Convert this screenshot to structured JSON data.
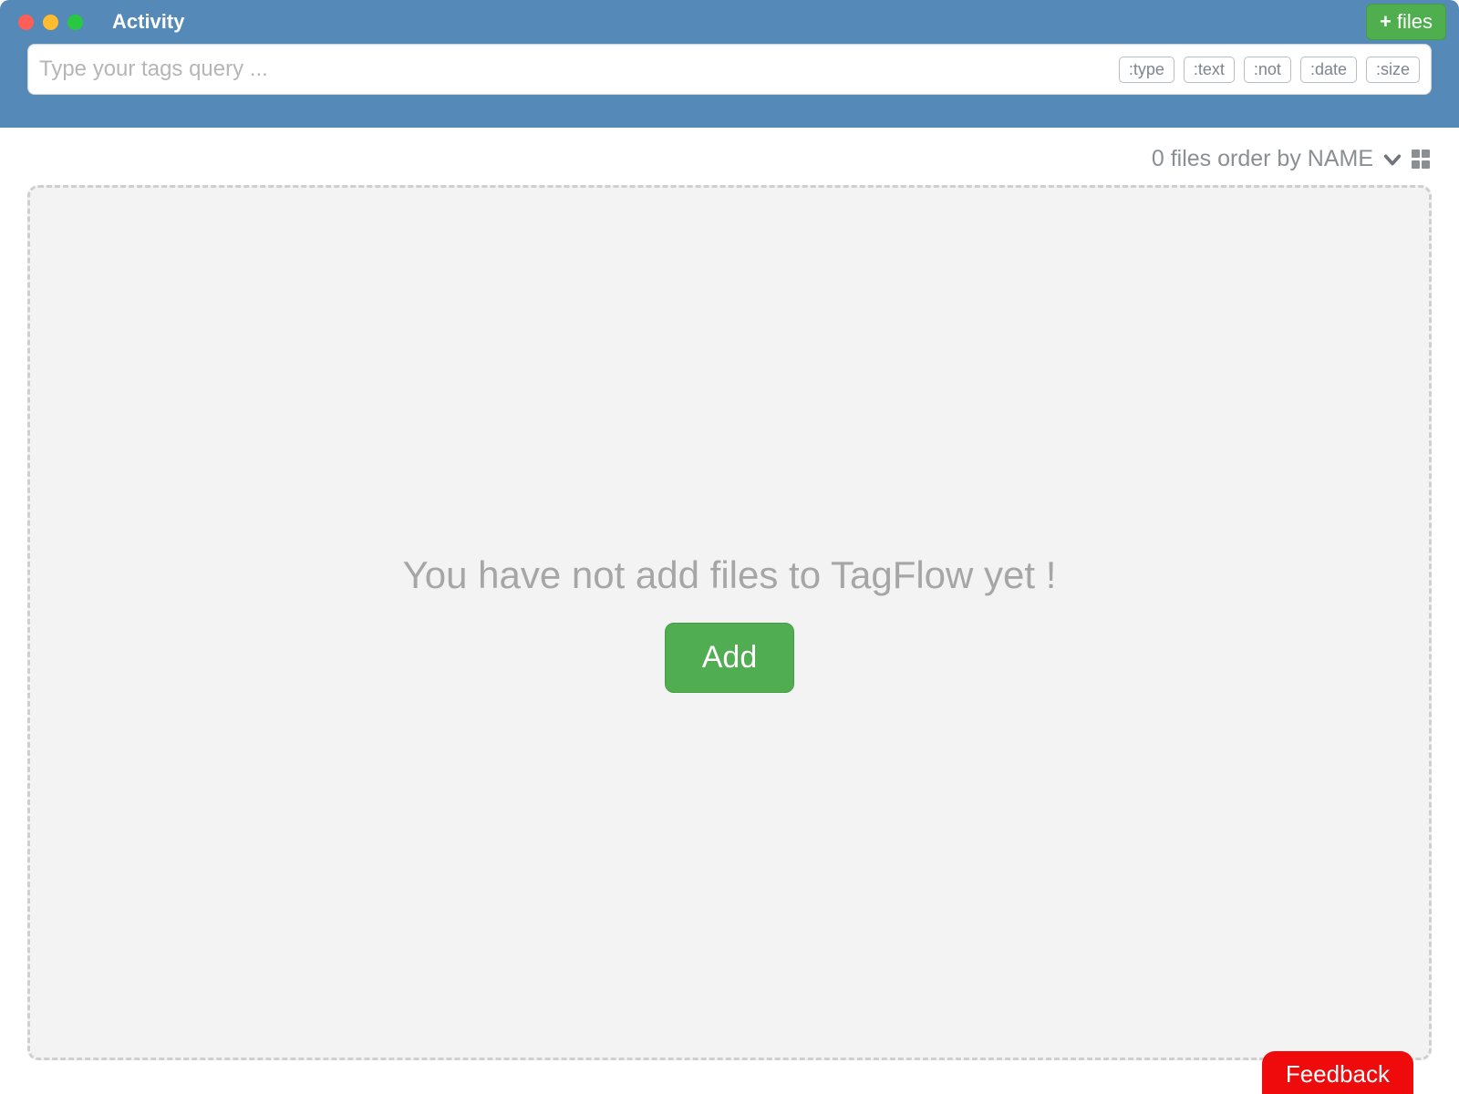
{
  "window": {
    "title": "Activity"
  },
  "header": {
    "add_files_label": "files"
  },
  "search": {
    "placeholder": "Type your tags query ...",
    "pills": [
      ":type",
      ":text",
      ":not",
      ":date",
      ":size"
    ]
  },
  "status": {
    "text": "0 files order by NAME"
  },
  "empty": {
    "message": "You have not add files to TagFlow yet !",
    "add_label": "Add"
  },
  "feedback": {
    "label": "Feedback"
  },
  "colors": {
    "header_bg": "#5589b7",
    "green_btn": "#4fae4e",
    "feedback_bg": "#ef0b0b"
  }
}
